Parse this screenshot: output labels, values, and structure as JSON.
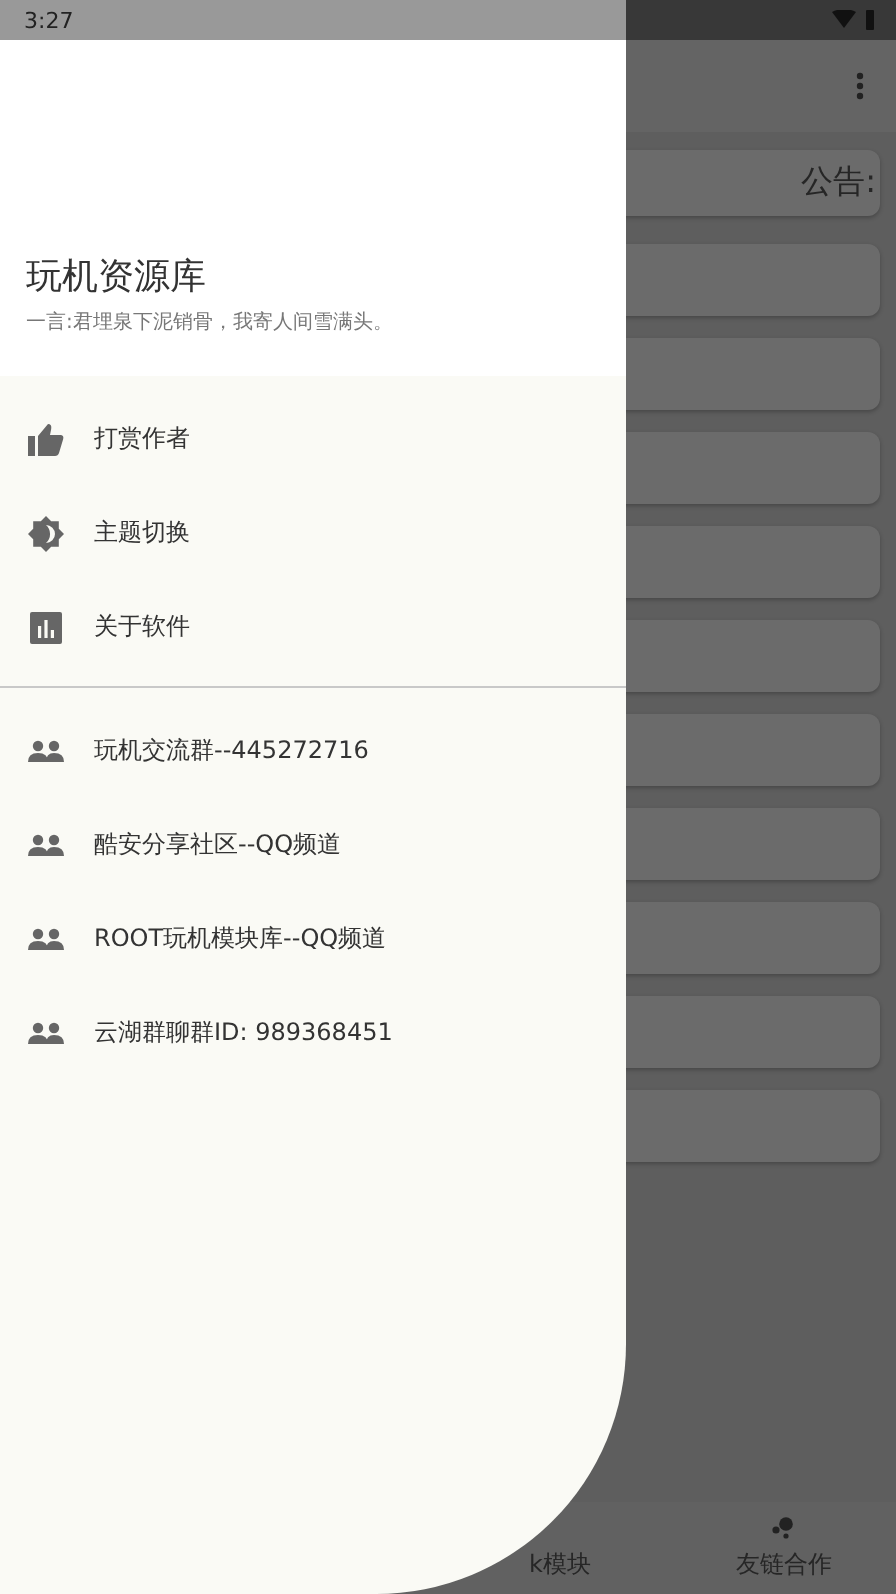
{
  "status_bar": {
    "time": "3:27"
  },
  "drawer": {
    "title": "玩机资源库",
    "subtitle": "一言:君埋泉下泥销骨，我寄人间雪满头。",
    "menu": [
      {
        "label": "打赏作者",
        "kind": "thumb"
      },
      {
        "label": "主题切换",
        "kind": "theme"
      },
      {
        "label": "关于软件",
        "kind": "chart"
      }
    ],
    "groups": [
      {
        "label": "玩机交流群--445272716"
      },
      {
        "label": "酷安分享社区--QQ频道"
      },
      {
        "label": "ROOT玩机模块库--QQ频道"
      },
      {
        "label": "云湖群聊群ID: 989368451"
      }
    ]
  },
  "background": {
    "notice": "公告:",
    "bottom_nav": [
      {
        "label": "k模块",
        "kind": "text"
      },
      {
        "label": "友链合作",
        "kind": "icon"
      }
    ]
  }
}
